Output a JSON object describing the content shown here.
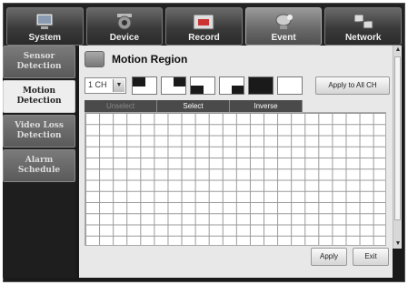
{
  "tabs": [
    {
      "label": "System",
      "icon": "system-icon"
    },
    {
      "label": "Device",
      "icon": "camera-icon"
    },
    {
      "label": "Record",
      "icon": "record-icon"
    },
    {
      "label": "Event",
      "icon": "event-icon"
    },
    {
      "label": "Network",
      "icon": "network-icon"
    }
  ],
  "active_tab": "Event",
  "sidebar": {
    "items": [
      {
        "label": "Sensor Detection"
      },
      {
        "label": "Motion Detection"
      },
      {
        "label": "Video Loss Detection"
      },
      {
        "label": "Alarm Schedule"
      }
    ],
    "active": "Motion Detection"
  },
  "main": {
    "title": "Motion Region",
    "channel": "1 CH",
    "apply_all_label": "Apply to All CH",
    "modes": [
      "Unselect",
      "Select",
      "Inverse"
    ],
    "apply_label": "Apply",
    "exit_label": "Exit"
  },
  "colors": {
    "grid_line": "#999999",
    "active_item": "#eeeeee",
    "dark": "#1a1a1a"
  }
}
